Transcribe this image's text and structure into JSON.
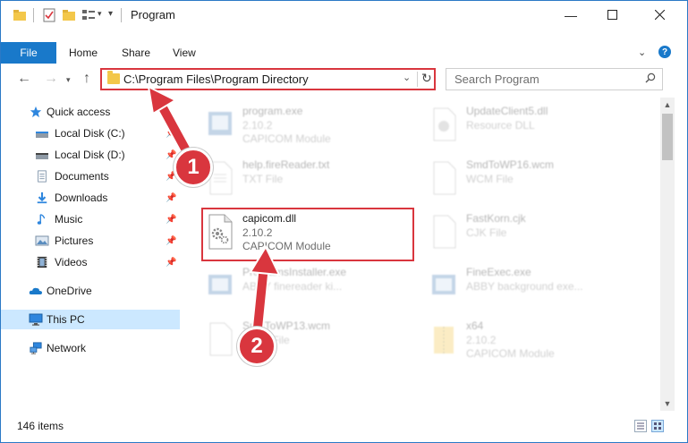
{
  "window": {
    "title": "Program"
  },
  "ribbon": {
    "tabs": [
      "File",
      "Home",
      "Share",
      "View"
    ]
  },
  "address": {
    "path": "C:\\Program Files\\Program Directory"
  },
  "search": {
    "placeholder": "Search Program"
  },
  "sidebar": {
    "items": [
      {
        "label": "Quick access",
        "icon": "star-icon"
      },
      {
        "label": "Local Disk (C:)",
        "icon": "drive-icon",
        "pinned": true
      },
      {
        "label": "Local Disk (D:)",
        "icon": "drive-icon",
        "pinned": true
      },
      {
        "label": "Documents",
        "icon": "documents-icon",
        "pinned": true
      },
      {
        "label": "Downloads",
        "icon": "download-icon",
        "pinned": true
      },
      {
        "label": "Music",
        "icon": "music-icon",
        "pinned": true
      },
      {
        "label": "Pictures",
        "icon": "pictures-icon",
        "pinned": true
      },
      {
        "label": "Videos",
        "icon": "videos-icon",
        "pinned": true
      },
      {
        "label": "OneDrive",
        "icon": "cloud-icon"
      },
      {
        "label": "This PC",
        "icon": "computer-icon",
        "selected": true
      },
      {
        "label": "Network",
        "icon": "network-icon"
      }
    ]
  },
  "files": [
    {
      "name": "program.exe",
      "line1": "2.10.2",
      "line2": "CAPICOM Module",
      "faded": true
    },
    {
      "name": "UpdateClient5.dll",
      "line1": "Resource DLL",
      "line2": "",
      "faded": true
    },
    {
      "name": "help.fireReader.txt",
      "line1": "TXT File",
      "line2": "",
      "faded": true
    },
    {
      "name": "SmdToWP16.wcm",
      "line1": "WCM File",
      "line2": "",
      "faded": true
    },
    {
      "name": "capicom.dll",
      "line1": "2.10.2",
      "line2": "CAPICOM Module",
      "faded": false
    },
    {
      "name": "FastKorn.cjk",
      "line1": "CJK File",
      "line2": "",
      "faded": true
    },
    {
      "name": "ProgramsInstaller.exe",
      "line1": "ABBY finereader ki...",
      "line2": "",
      "faded": true
    },
    {
      "name": "FineExec.exe",
      "line1": "ABBY background exe...",
      "line2": "",
      "faded": true
    },
    {
      "name": "SmdToWP13.wcm",
      "line1": "WCM File",
      "line2": "",
      "faded": true
    },
    {
      "name": "x64",
      "line1": "2.10.2",
      "line2": "CAPICOM Module",
      "faded": true
    }
  ],
  "status": {
    "items_count": "146 items"
  },
  "annotations": {
    "step1": "1",
    "step2": "2"
  },
  "colors": {
    "accent": "#1979ca",
    "highlight": "#d9363e",
    "selection": "#cce8ff"
  }
}
